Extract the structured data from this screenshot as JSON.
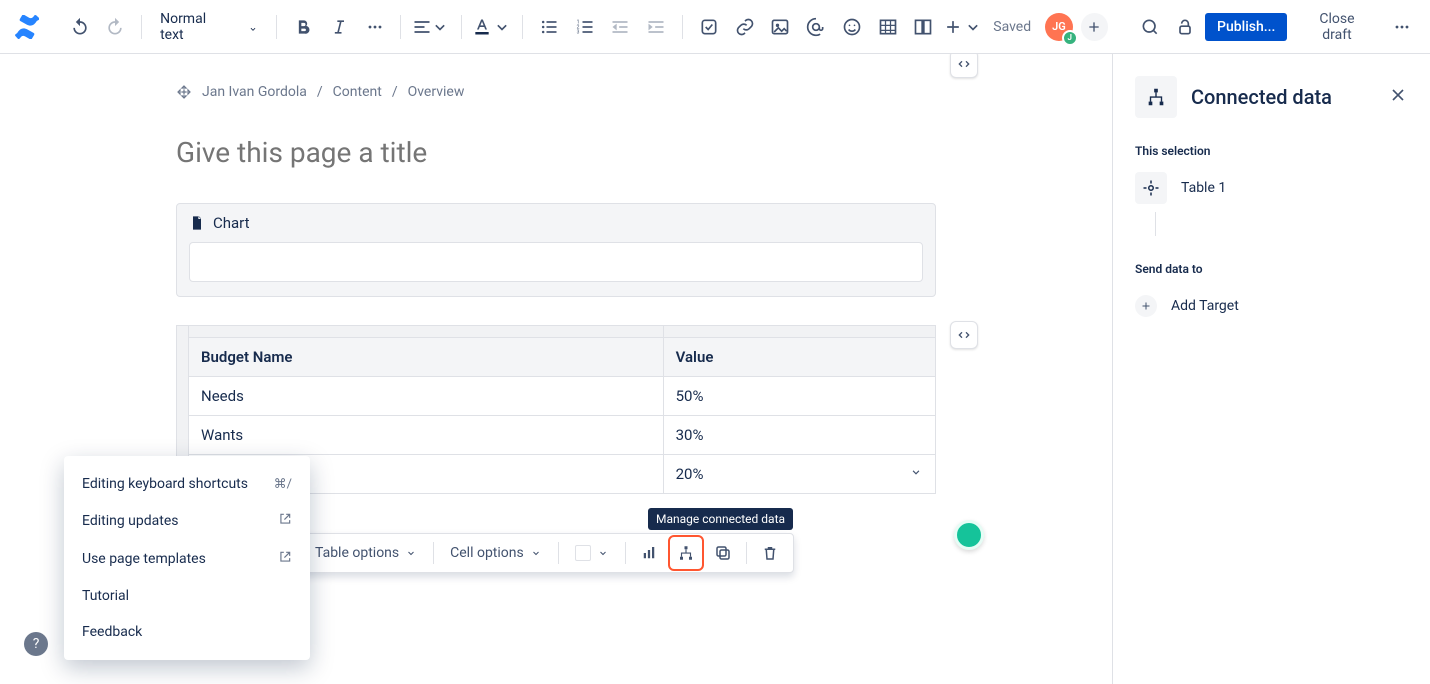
{
  "toolbar": {
    "text_style": "Normal text",
    "saved": "Saved",
    "avatar_initials": "JG",
    "avatar_presence_initial": "J",
    "publish": "Publish...",
    "close_draft": "Close draft"
  },
  "breadcrumb": {
    "user": "Jan Ivan Gordola",
    "content": "Content",
    "overview": "Overview"
  },
  "page": {
    "title_placeholder": "Give this page a title",
    "chart_label": "Chart"
  },
  "table": {
    "headers": {
      "col1": "Budget Name",
      "col2": "Value"
    },
    "rows": [
      {
        "name": "Needs",
        "value": "50%"
      },
      {
        "name": "Wants",
        "value": "30%"
      },
      {
        "name": "",
        "value": "20%"
      }
    ]
  },
  "float_tb": {
    "table_options": "Table options",
    "cell_options": "Cell options",
    "tooltip": "Manage connected data"
  },
  "right_panel": {
    "title": "Connected data",
    "this_selection": "This selection",
    "selection_item": "Table 1",
    "send_data_to": "Send data to",
    "add_target": "Add Target"
  },
  "help": {
    "shortcuts": "Editing keyboard shortcuts",
    "shortcuts_key": "⌘/",
    "updates": "Editing updates",
    "templates": "Use page templates",
    "tutorial": "Tutorial",
    "feedback": "Feedback"
  },
  "chart_data": {
    "type": "table",
    "columns": [
      "Budget Name",
      "Value"
    ],
    "rows": [
      [
        "Needs",
        "50%"
      ],
      [
        "Wants",
        "30%"
      ],
      [
        "",
        "20%"
      ]
    ]
  }
}
